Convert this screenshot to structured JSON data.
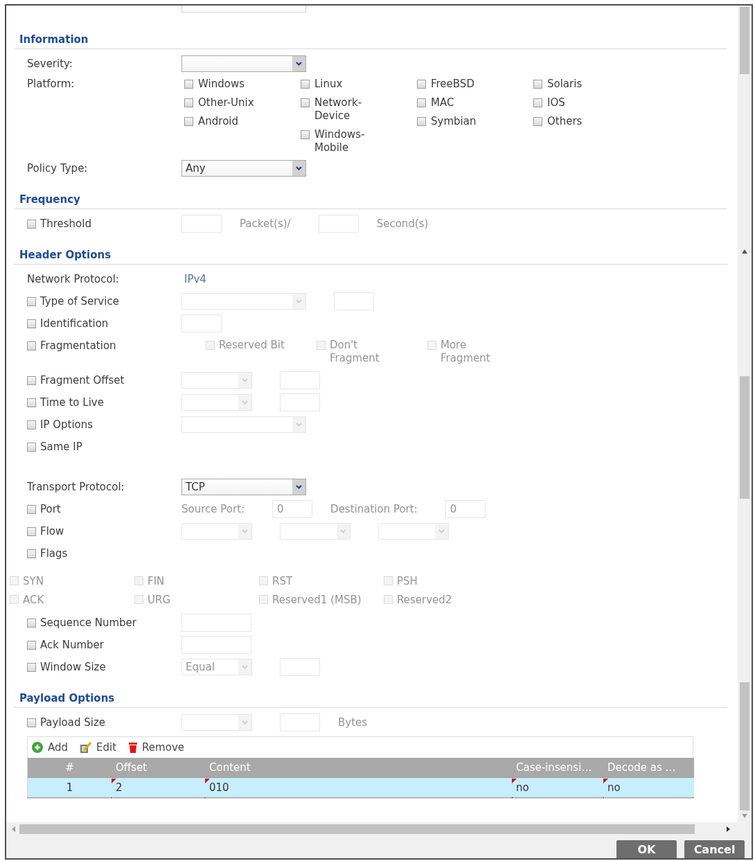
{
  "sections": [
    {
      "title": "Information",
      "rows": [
        {
          "kind": "select",
          "label": "Severity:",
          "disabled": false
        },
        {
          "kind": "checkboxes",
          "label": "Platform:",
          "columns": [
            {
              "options": [
                {
                  "label": "Windows",
                  "checked": false
                },
                {
                  "label": "Other-Unix",
                  "checked": false
                },
                {
                  "label": "Android",
                  "checked": false
                }
              ]
            },
            {
              "options": [
                {
                  "label": "Linux",
                  "checked": false
                },
                {
                  "label": "Network-Device",
                  "checked": false
                },
                {
                  "label": "Windows-Mobile",
                  "checked": false
                }
              ]
            },
            {
              "options": [
                {
                  "label": "FreeBSD",
                  "checked": false
                },
                {
                  "label": "MAC",
                  "checked": false
                },
                {
                  "label": "Symbian",
                  "checked": false
                }
              ]
            },
            {
              "options": [
                {
                  "label": "Solaris",
                  "checked": false
                },
                {
                  "label": "IOS",
                  "checked": false
                },
                {
                  "label": "Others",
                  "checked": false
                }
              ]
            }
          ]
        },
        {
          "kind": "select",
          "label": "Policy Type:",
          "value": "Any",
          "disabled": false
        }
      ]
    },
    {
      "title": "Frequency",
      "rows": [
        {
          "kind": "option",
          "label": "Threshold",
          "checked": false,
          "controls": [
            {
              "kind": "input",
              "disabled": true
            },
            {
              "kind": "text",
              "label": "Packet(s)/",
              "disabled": true
            },
            {
              "kind": "input",
              "disabled": true
            },
            {
              "kind": "text",
              "label": "Second(s)",
              "disabled": true
            }
          ]
        }
      ]
    },
    {
      "title": "Header Options",
      "rows": [
        {
          "kind": "value",
          "label": "Network Protocol:",
          "value": "IPv4"
        },
        {
          "kind": "option",
          "label": "Type of Service",
          "checked": false,
          "controls": [
            {
              "kind": "select",
              "disabled": true
            },
            {
              "kind": "input",
              "disabled": true
            }
          ]
        },
        {
          "kind": "option",
          "label": "Identification",
          "checked": false,
          "controls": [
            {
              "kind": "input",
              "disabled": true
            }
          ]
        },
        {
          "kind": "option",
          "label": "Fragmentation",
          "checked": false,
          "controls": [
            {
              "kind": "checkbox",
              "label": "Reserved Bit",
              "checked": false,
              "disabled": true
            },
            {
              "kind": "checkbox",
              "label": "Don't Fragment",
              "checked": false,
              "disabled": true
            },
            {
              "kind": "checkbox",
              "label": "More Fragment",
              "checked": false,
              "disabled": true
            }
          ]
        },
        {
          "kind": "option",
          "label": "Fragment Offset",
          "checked": false,
          "controls": [
            {
              "kind": "short-select",
              "disabled": true
            },
            {
              "kind": "input",
              "disabled": true
            }
          ]
        },
        {
          "kind": "option",
          "label": "Time to Live",
          "checked": false,
          "controls": [
            {
              "kind": "short-select",
              "disabled": true
            },
            {
              "kind": "input",
              "disabled": true
            }
          ]
        },
        {
          "kind": "option",
          "label": "IP Options",
          "checked": false,
          "controls": [
            {
              "kind": "select",
              "disabled": true
            }
          ]
        },
        {
          "kind": "option",
          "label": "Same IP",
          "checked": false
        },
        {
          "kind": "select",
          "label": "Transport Protocol:",
          "value": "TCP",
          "disabled": false
        },
        {
          "kind": "option",
          "label": "Port",
          "checked": false,
          "controls": [
            {
              "kind": "text",
              "label": "Source Port:",
              "disabled": true
            },
            {
              "kind": "input",
              "value": "0",
              "disabled": true
            },
            {
              "kind": "text",
              "label": "Destination Port:",
              "disabled": true
            },
            {
              "kind": "input",
              "value": "0",
              "disabled": true
            }
          ]
        },
        {
          "kind": "option",
          "label": "Flow",
          "checked": false,
          "controls": [
            {
              "kind": "short-select",
              "disabled": true
            },
            {
              "kind": "short-select",
              "disabled": true
            },
            {
              "kind": "short-select",
              "disabled": true
            }
          ]
        },
        {
          "kind": "option",
          "label": "Flags",
          "checked": false
        },
        {
          "kind": "flags",
          "items": [
            {
              "label": "SYN",
              "checked": false,
              "disabled": true
            },
            {
              "label": "FIN",
              "checked": false,
              "disabled": true
            },
            {
              "label": "RST",
              "checked": false,
              "disabled": true
            },
            {
              "label": "PSH",
              "checked": false,
              "disabled": true
            },
            {
              "label": "ACK",
              "checked": false,
              "disabled": true
            },
            {
              "label": "URG",
              "checked": false,
              "disabled": true
            },
            {
              "label": "Reserved1 (MSB)",
              "checked": false,
              "disabled": true
            },
            {
              "label": "Reserved2",
              "checked": false,
              "disabled": true
            }
          ]
        },
        {
          "kind": "option",
          "label": "Sequence Number",
          "checked": false,
          "controls": [
            {
              "kind": "long-input",
              "disabled": true
            }
          ]
        },
        {
          "kind": "option",
          "label": "Ack Number",
          "checked": false,
          "controls": [
            {
              "kind": "long-input",
              "disabled": true
            }
          ]
        },
        {
          "kind": "option",
          "label": "Window Size",
          "checked": false,
          "controls": [
            {
              "kind": "short-select",
              "value": "Equal",
              "disabled": true
            },
            {
              "kind": "input",
              "disabled": true
            }
          ]
        }
      ]
    },
    {
      "title": "Payload Options",
      "rows": [
        {
          "kind": "option",
          "label": "Payload Size",
          "checked": false,
          "controls": [
            {
              "kind": "short-select",
              "disabled": true
            },
            {
              "kind": "input",
              "disabled": true
            },
            {
              "kind": "text",
              "label": "Bytes",
              "disabled": true
            }
          ]
        },
        {
          "kind": "table",
          "toolbar": [
            {
              "kind": "add",
              "label": "Add"
            },
            {
              "kind": "edit",
              "label": "Edit"
            },
            {
              "kind": "remove",
              "label": "Remove"
            }
          ],
          "columns": [
            "#",
            "Offset",
            "Content",
            "Case-insensi…",
            "Decode as …"
          ],
          "rows": [
            {
              "selected": true,
              "cells": [
                {
                  "text": "1",
                  "modified": false
                },
                {
                  "text": "2",
                  "modified": true
                },
                {
                  "text": "010",
                  "modified": true
                },
                {
                  "text": "no",
                  "modified": true
                },
                {
                  "text": "no",
                  "modified": true
                }
              ]
            }
          ]
        }
      ]
    }
  ],
  "buttons": [
    "OK",
    "Cancel"
  ]
}
